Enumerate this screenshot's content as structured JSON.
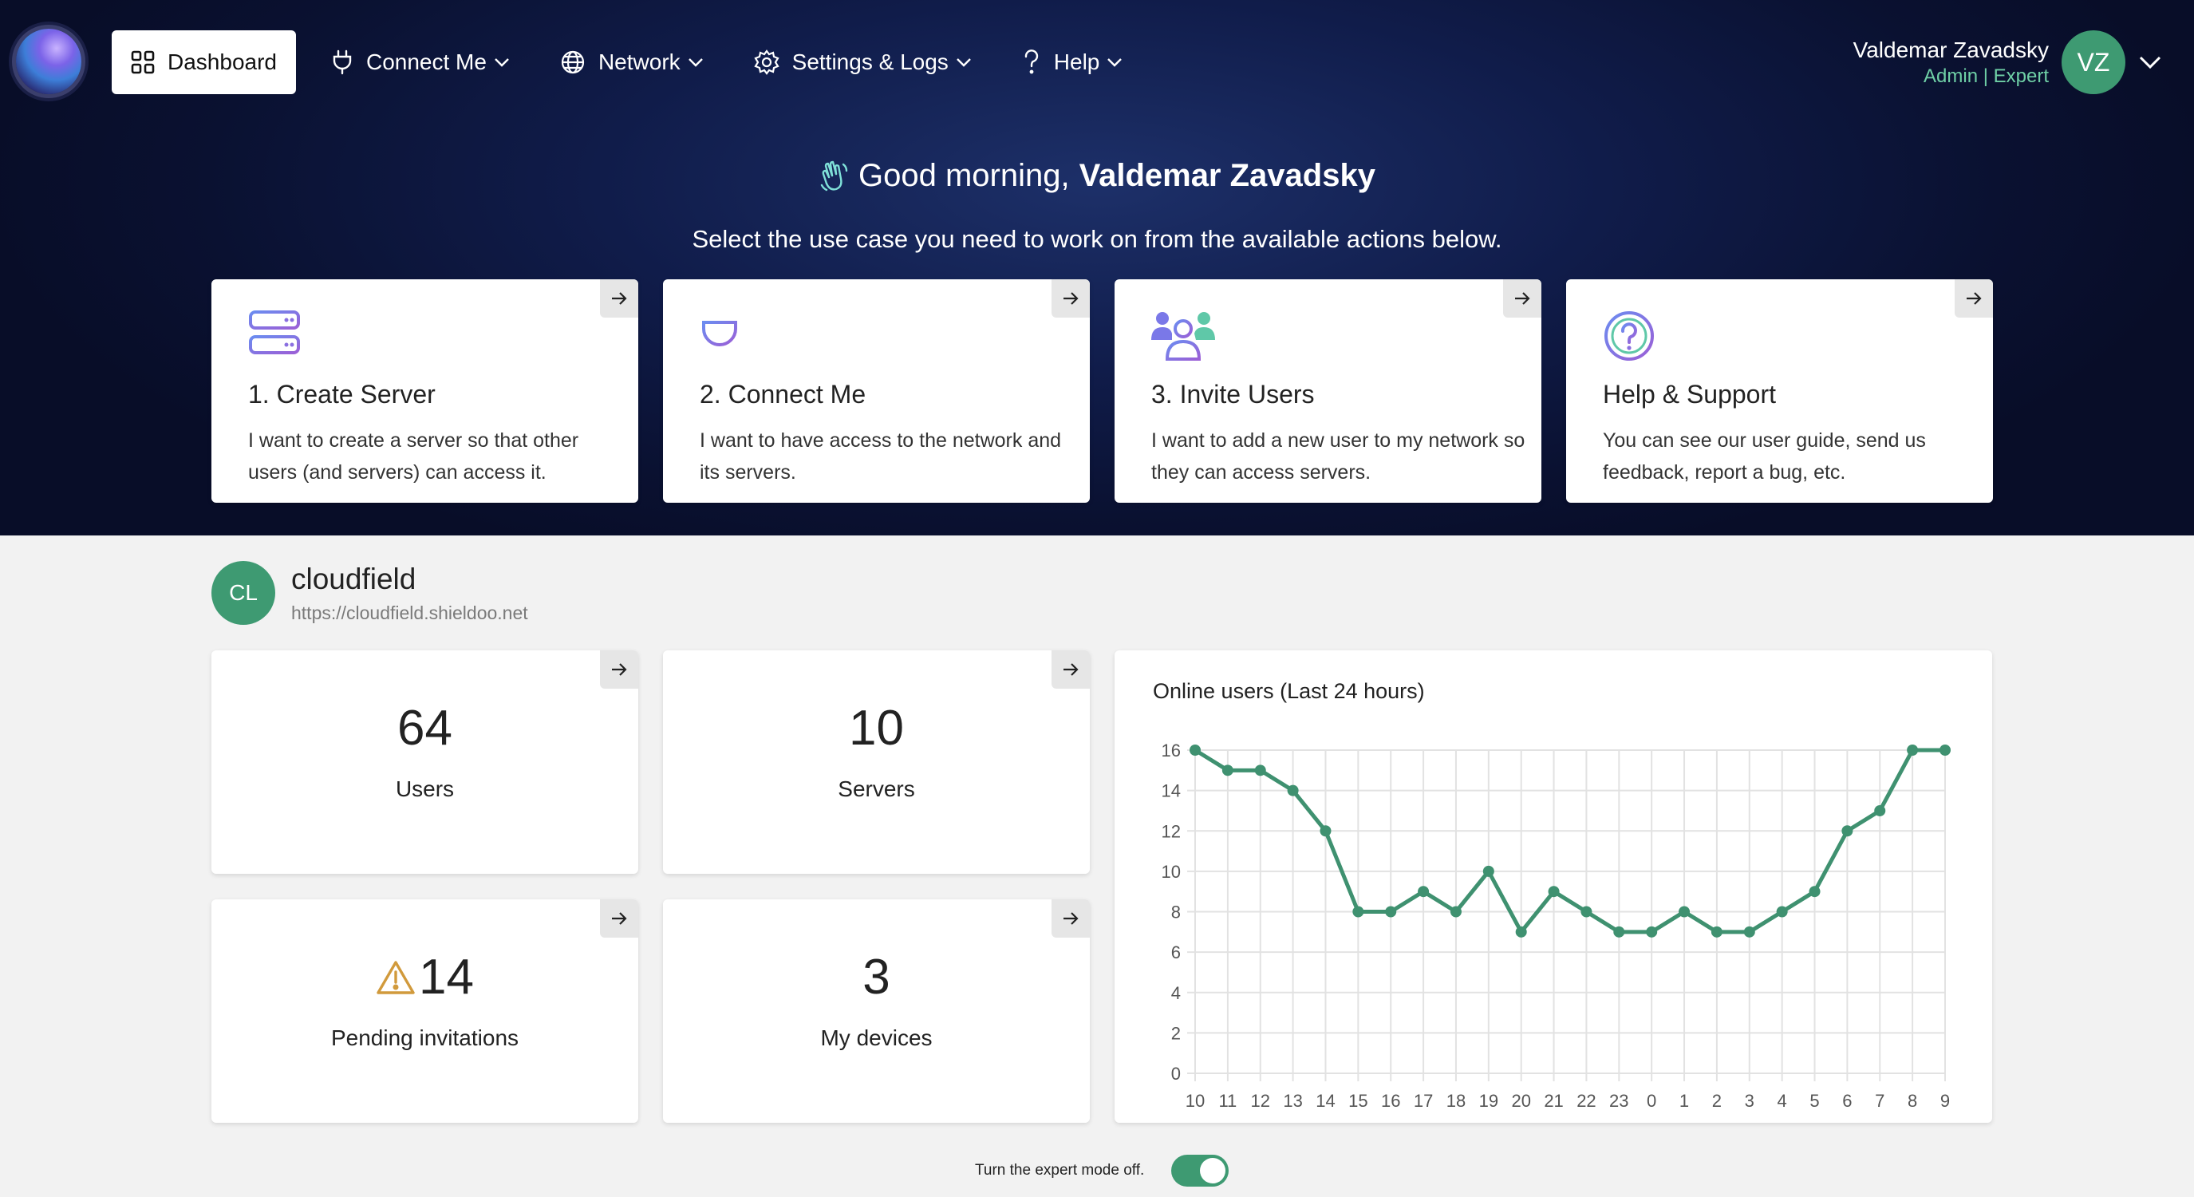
{
  "nav": {
    "items": [
      {
        "label": "Dashboard",
        "icon": "grid-icon"
      },
      {
        "label": "Connect Me",
        "icon": "plug-icon"
      },
      {
        "label": "Network",
        "icon": "globe-icon"
      },
      {
        "label": "Settings & Logs",
        "icon": "gear-icon"
      },
      {
        "label": "Help",
        "icon": "question-icon"
      }
    ]
  },
  "user": {
    "name": "Valdemar Zavadsky",
    "role": "Admin | Expert",
    "initials": "VZ"
  },
  "greeting": {
    "prefix": "Good morning,",
    "name": "Valdemar Zavadsky"
  },
  "subtitle": "Select the use case you need to work on from the available actions below.",
  "actions": [
    {
      "title": "1. Create Server",
      "desc": "I want to create a server so that other users (and servers) can access it.",
      "icon": "server-icon"
    },
    {
      "title": "2. Connect Me",
      "desc": "I want to have access to the network and its servers.",
      "icon": "plug-icon"
    },
    {
      "title": "3. Invite Users",
      "desc": "I want to add a new user to my network so they can access servers.",
      "icon": "users-icon"
    },
    {
      "title": "Help & Support",
      "desc": "You can see our user guide, send us feedback, report a bug, etc.",
      "icon": "question-circle-icon"
    }
  ],
  "org": {
    "initials": "CL",
    "name": "cloudfield",
    "url": "https://cloudfield.shieldoo.net"
  },
  "stats": [
    {
      "value": "64",
      "label": "Users"
    },
    {
      "value": "10",
      "label": "Servers"
    },
    {
      "value": "14",
      "label": "Pending invitations",
      "icon": "warning-icon"
    },
    {
      "value": "3",
      "label": "My devices"
    }
  ],
  "chart_data": {
    "type": "line",
    "title": "Online users (Last 24 hours)",
    "x": [
      "10",
      "11",
      "12",
      "13",
      "14",
      "15",
      "16",
      "17",
      "18",
      "19",
      "20",
      "21",
      "22",
      "23",
      "0",
      "1",
      "2",
      "3",
      "4",
      "5",
      "6",
      "7",
      "8",
      "9"
    ],
    "values": [
      16,
      15,
      15,
      14,
      12,
      8,
      8,
      9,
      8,
      10,
      7,
      9,
      8,
      7,
      7,
      8,
      7,
      7,
      8,
      9,
      12,
      13,
      16,
      16
    ],
    "ylim": [
      0,
      16
    ],
    "yticks": [
      0,
      2,
      4,
      6,
      8,
      10,
      12,
      14,
      16
    ],
    "grid": true,
    "color": "#3f9170"
  },
  "footer": {
    "expert_toggle_label": "Turn the expert mode off.",
    "expert_mode_on": true
  },
  "colors": {
    "accent": "#3e9a72",
    "hero_dark": "#0a1131",
    "role_text": "#6fd0a6"
  }
}
